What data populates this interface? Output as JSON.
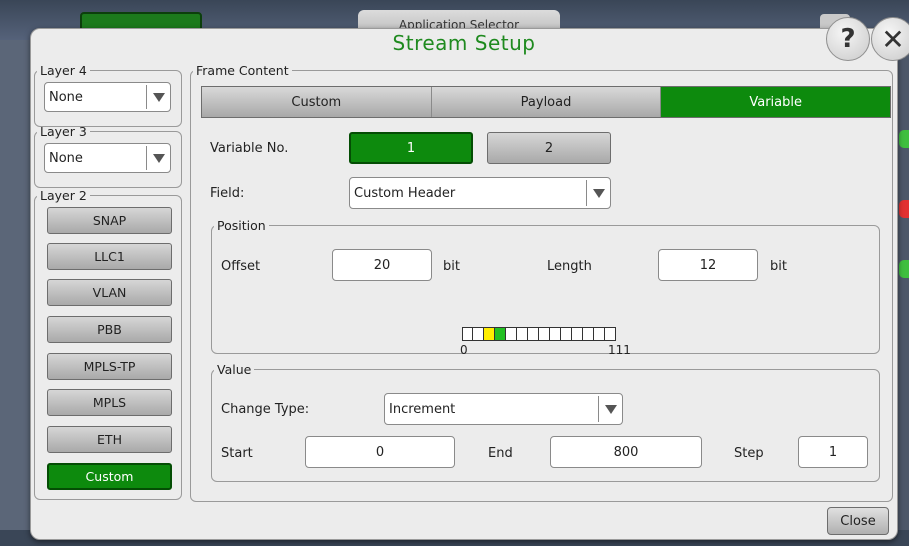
{
  "background": {
    "app_selector_label": "Application Selector"
  },
  "dialog": {
    "title": "Stream Setup",
    "help_label": "?",
    "close_x_label": "✕",
    "close_label": "Close"
  },
  "layer4": {
    "legend": "Layer 4",
    "value": "None"
  },
  "layer3": {
    "legend": "Layer 3",
    "value": "None"
  },
  "layer2": {
    "legend": "Layer 2",
    "buttons": [
      "SNAP",
      "LLC1",
      "VLAN",
      "PBB",
      "MPLS-TP",
      "MPLS",
      "ETH",
      "Custom"
    ],
    "active": "Custom"
  },
  "frame_content": {
    "legend": "Frame Content",
    "tabs": [
      "Custom",
      "Payload",
      "Variable"
    ],
    "active_tab": "Variable",
    "variable_no_label": "Variable No.",
    "variable_buttons": [
      "1",
      "2"
    ],
    "active_variable": "1",
    "field_label": "Field:",
    "field_value": "Custom Header",
    "position": {
      "legend": "Position",
      "offset_label": "Offset",
      "offset_value": "20",
      "offset_unit": "bit",
      "length_label": "Length",
      "length_value": "12",
      "length_unit": "bit",
      "scale_start": "0",
      "scale_end": "111"
    },
    "value": {
      "legend": "Value",
      "change_type_label": "Change Type:",
      "change_type_value": "Increment",
      "start_label": "Start",
      "start_value": "0",
      "end_label": "End",
      "end_value": "800",
      "step_label": "Step",
      "step_value": "1"
    }
  },
  "colors": {
    "accent_green": "#0d8a0d",
    "title_green": "#1f8a1f",
    "bit_yellow": "#ffee00",
    "bit_green": "#22c022"
  }
}
